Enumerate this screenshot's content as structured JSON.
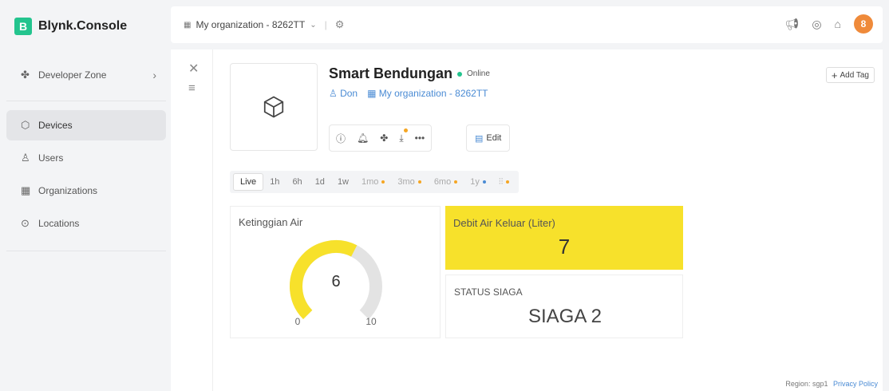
{
  "app": {
    "logo_letter": "B",
    "name": "Blynk.Console"
  },
  "sidebar": {
    "developer_zone": "Developer Zone",
    "items": [
      {
        "label": "Devices",
        "icon": "cube-icon"
      },
      {
        "label": "Users",
        "icon": "users-icon"
      },
      {
        "label": "Organizations",
        "icon": "building-icon"
      },
      {
        "label": "Locations",
        "icon": "location-pin-icon"
      }
    ]
  },
  "topbar": {
    "org_name": "My organization - 8262TT",
    "avatar_letter": "8"
  },
  "device": {
    "name": "Smart Bendungan",
    "status": "Online",
    "owner": "Don",
    "org": "My organization - 8262TT",
    "edit_label": "Edit",
    "add_tag_label": "Add Tag"
  },
  "time_ranges": [
    {
      "label": "Live",
      "active": true,
      "dot": ""
    },
    {
      "label": "1h",
      "active": false,
      "dot": ""
    },
    {
      "label": "6h",
      "active": false,
      "dot": ""
    },
    {
      "label": "1d",
      "active": false,
      "dot": ""
    },
    {
      "label": "1w",
      "active": false,
      "dot": ""
    },
    {
      "label": "1mo",
      "active": false,
      "dot": "#f5a623"
    },
    {
      "label": "3mo",
      "active": false,
      "dot": "#f5a623"
    },
    {
      "label": "6mo",
      "active": false,
      "dot": "#f5a623"
    },
    {
      "label": "1y",
      "active": false,
      "dot": "#4a8bd4"
    }
  ],
  "widgets": {
    "gauge": {
      "title": "Ketinggian Air",
      "value": 6,
      "min": 0,
      "max": 10,
      "min_label": "0",
      "max_label": "10",
      "color": "#f7e12b"
    },
    "debit": {
      "title": "Debit Air Keluar (Liter)",
      "value": "7",
      "color": "#f7e12b"
    },
    "siaga": {
      "title": "STATUS SIAGA",
      "value": "SIAGA 2"
    }
  },
  "footer": {
    "region": "Region: sgp1",
    "privacy": "Privacy Policy"
  },
  "colors": {
    "brand": "#23c48e",
    "online": "#23c48e",
    "link": "#4a8bd4"
  }
}
